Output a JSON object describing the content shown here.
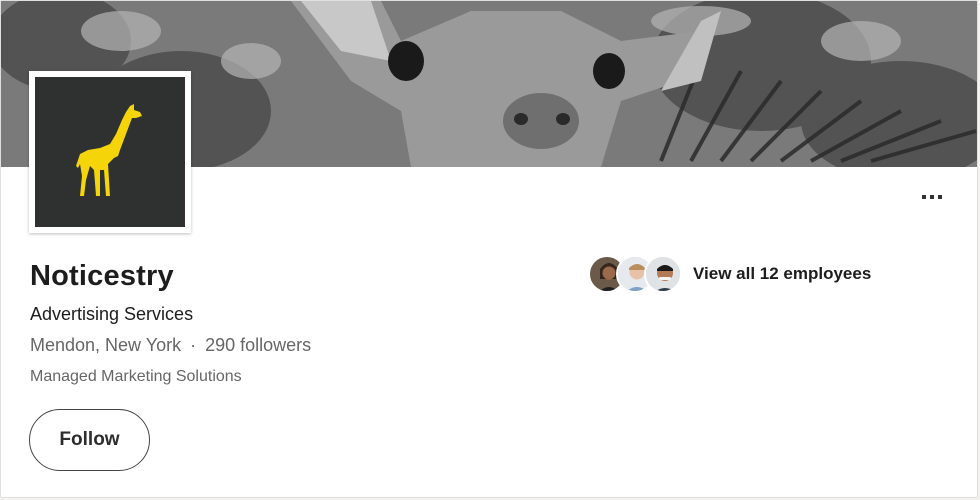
{
  "company": {
    "name": "Noticestry",
    "industry": "Advertising Services",
    "location": "Mendon, New York",
    "separator": "·",
    "followers": "290 followers",
    "tagline": "Managed Marketing Solutions"
  },
  "actions": {
    "follow_label": "Follow",
    "more_icon": "ellipsis-icon"
  },
  "employees": {
    "label": "View all 12 employees",
    "avatar_count": 3
  },
  "colors": {
    "logo_background": "#2f3030",
    "logo_accent": "#f5d40a"
  }
}
